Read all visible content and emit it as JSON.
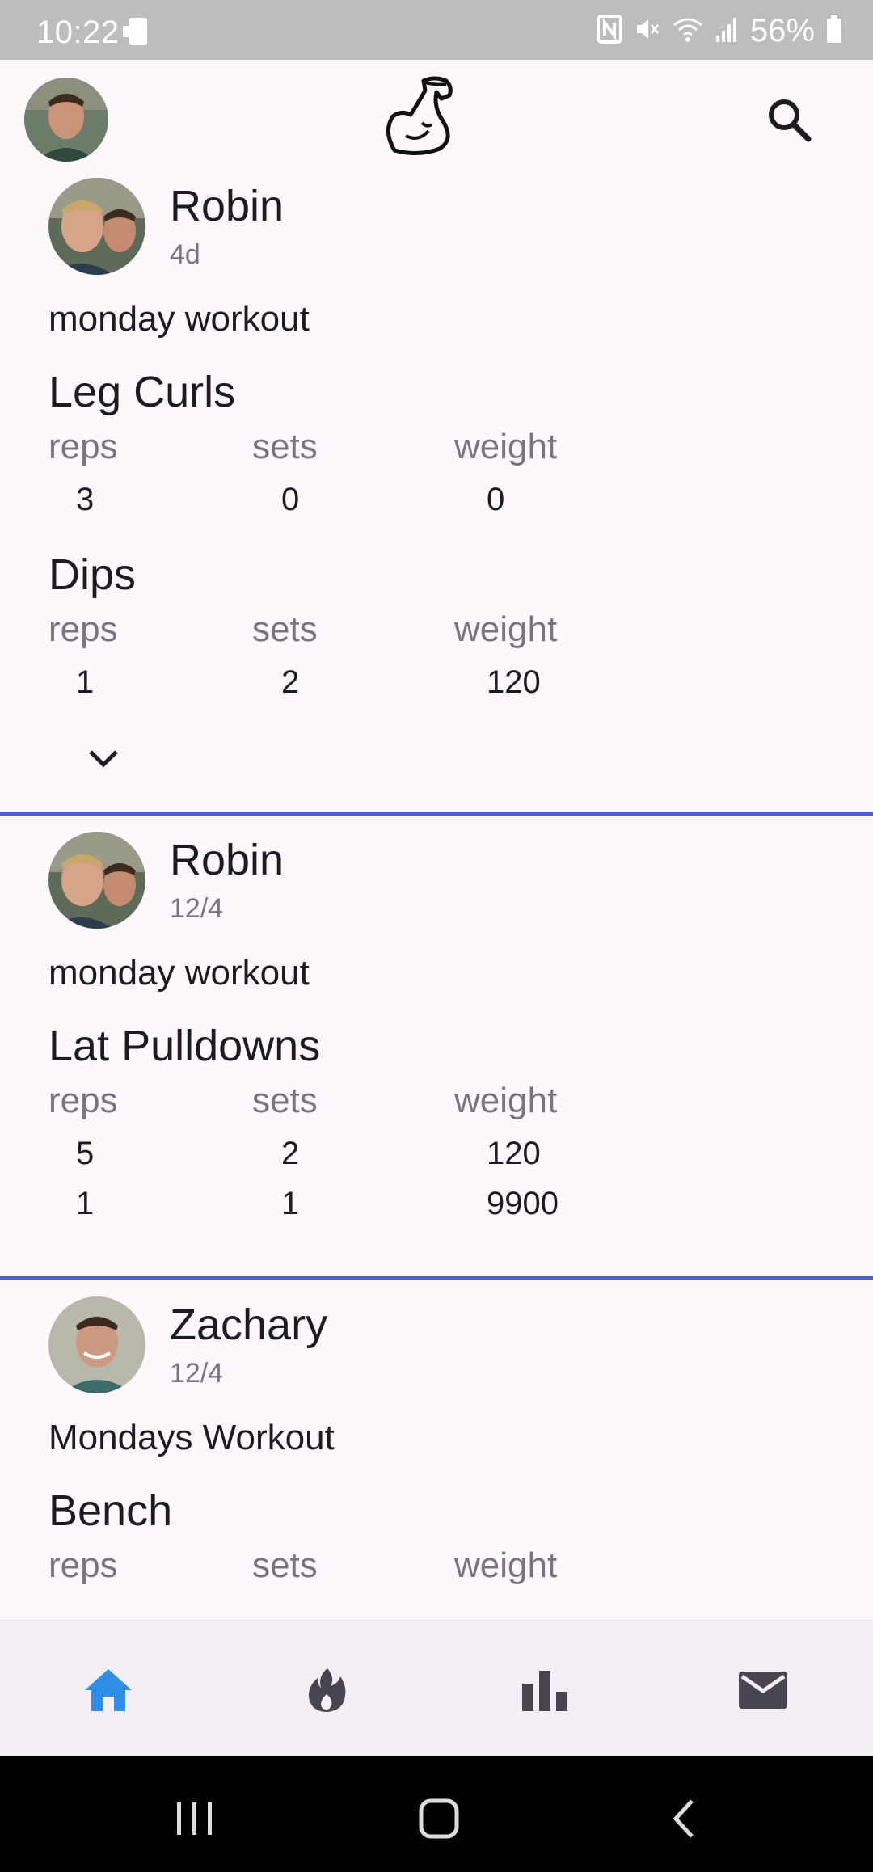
{
  "status_bar": {
    "time": "10:22",
    "battery": "56%"
  },
  "app_bar": {
    "profile_icon": "user-avatar",
    "logo_icon": "flexed-bicep-icon",
    "search_icon": "search-icon"
  },
  "posts": [
    {
      "author": "Robin",
      "date": "4d",
      "workout_title": "monday workout",
      "exercises": [
        {
          "name": "Leg Curls",
          "headers": [
            "reps",
            "sets",
            "weight"
          ],
          "rows": [
            [
              "3",
              "0",
              "0"
            ]
          ]
        },
        {
          "name": "Dips",
          "headers": [
            "reps",
            "sets",
            "weight"
          ],
          "rows": [
            [
              "1",
              "2",
              "120"
            ]
          ]
        }
      ],
      "expand_icon": "chevron-down-icon"
    },
    {
      "author": "Robin",
      "date": "12/4",
      "workout_title": "monday workout",
      "exercises": [
        {
          "name": "Lat Pulldowns",
          "headers": [
            "reps",
            "sets",
            "weight"
          ],
          "rows": [
            [
              "5",
              "2",
              "120"
            ],
            [
              "1",
              "1",
              "9900"
            ]
          ]
        }
      ]
    },
    {
      "author": "Zachary",
      "date": "12/4",
      "workout_title": "Mondays Workout",
      "exercises": [
        {
          "name": "Bench",
          "headers": [
            "reps",
            "sets",
            "weight"
          ],
          "rows": []
        }
      ]
    }
  ],
  "bottom_nav": {
    "items": [
      "home-icon",
      "flame-icon",
      "bar-chart-icon",
      "mail-icon"
    ],
    "active_index": 0,
    "active_color": "#2f8ee5",
    "inactive_color": "#49454f"
  },
  "colors": {
    "divider": "#4b5fd1",
    "status_bar": "#bdbdbd"
  }
}
